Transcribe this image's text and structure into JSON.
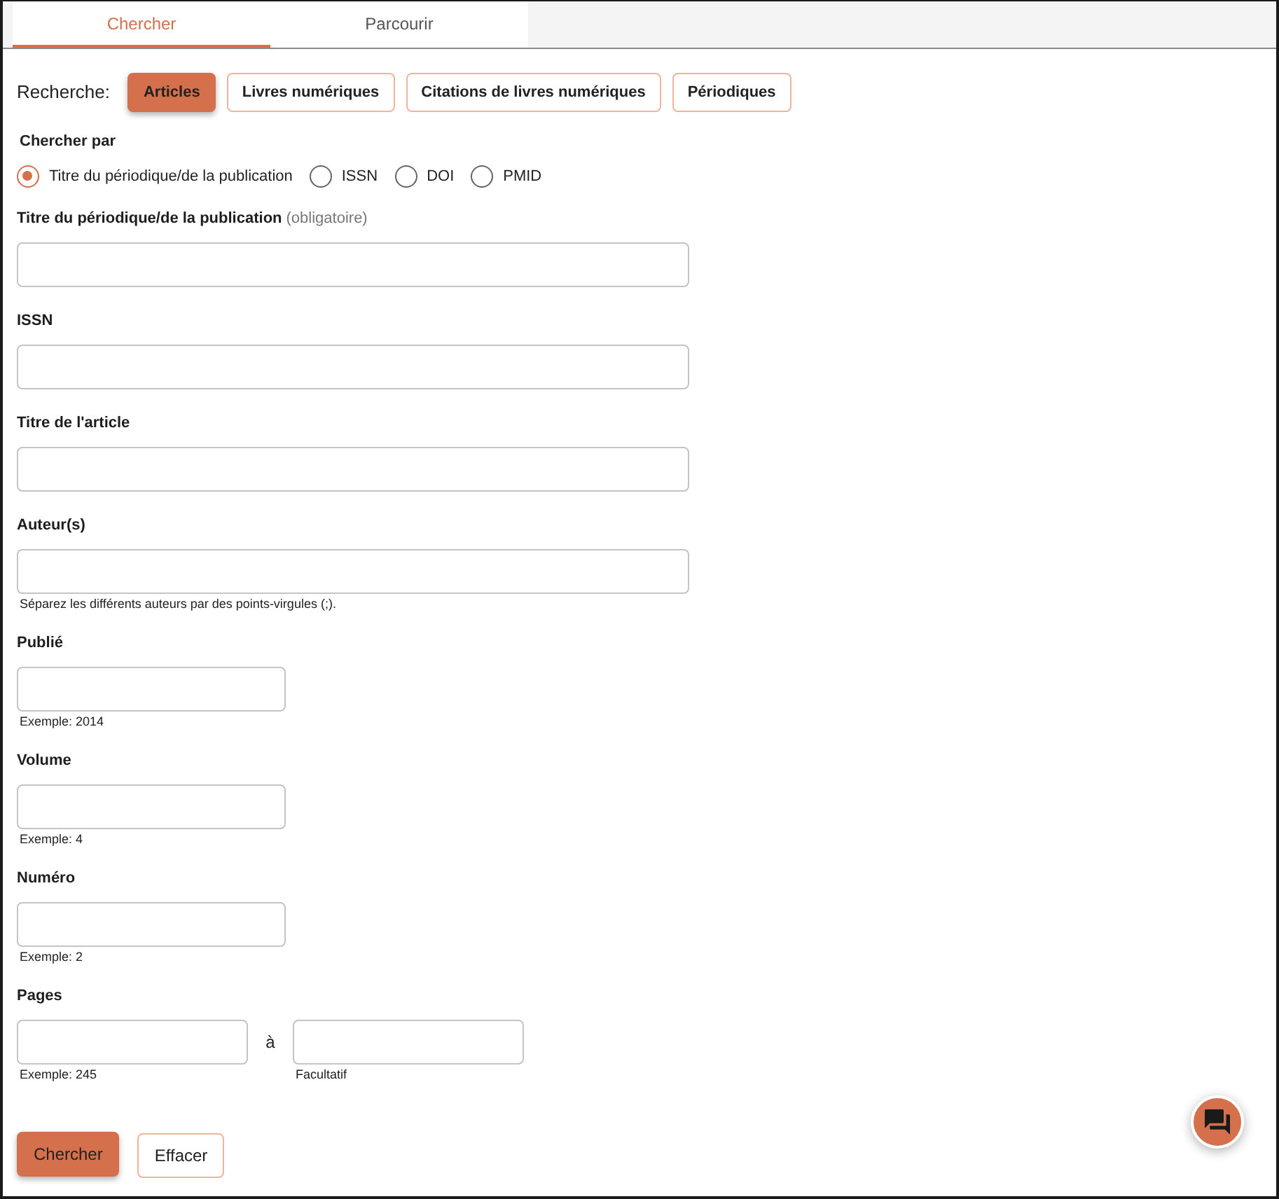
{
  "tabs": [
    {
      "label": "Chercher",
      "selected": true
    },
    {
      "label": "Parcourir",
      "selected": false
    }
  ],
  "search_type": {
    "label": "Recherche:",
    "options": [
      {
        "label": "Articles",
        "selected": true
      },
      {
        "label": "Livres numériques",
        "selected": false
      },
      {
        "label": "Citations de livres numériques",
        "selected": false
      },
      {
        "label": "Périodiques",
        "selected": false
      }
    ]
  },
  "search_by": {
    "label": "Chercher par",
    "options": [
      {
        "label": "Titre du périodique/de la publication",
        "selected": true
      },
      {
        "label": "ISSN",
        "selected": false
      },
      {
        "label": "DOI",
        "selected": false
      },
      {
        "label": "PMID",
        "selected": false
      }
    ]
  },
  "fields": [
    {
      "kind": "wide",
      "label": "Titre du périodique/de la publication",
      "note": "(obligatoire)"
    },
    {
      "kind": "wide",
      "label": "ISSN"
    },
    {
      "kind": "wide",
      "label": "Titre de l'article"
    },
    {
      "kind": "wide",
      "label": "Auteur(s)",
      "hint": "Séparez les différents auteurs par des points-virgules (;)."
    },
    {
      "kind": "short",
      "label": "Publié",
      "hint": "Exemple: 2014"
    },
    {
      "kind": "short",
      "label": "Volume",
      "hint": "Exemple: 4"
    },
    {
      "kind": "short",
      "label": "Numéro",
      "hint": "Exemple: 2"
    },
    {
      "kind": "range",
      "label": "Pages",
      "separator": "à",
      "from_hint": "Exemple: 245",
      "to_hint": "Facultatif"
    }
  ],
  "buttons": [
    {
      "label": "Chercher",
      "kind": "primary"
    },
    {
      "label": "Effacer",
      "kind": "secondary"
    }
  ]
}
